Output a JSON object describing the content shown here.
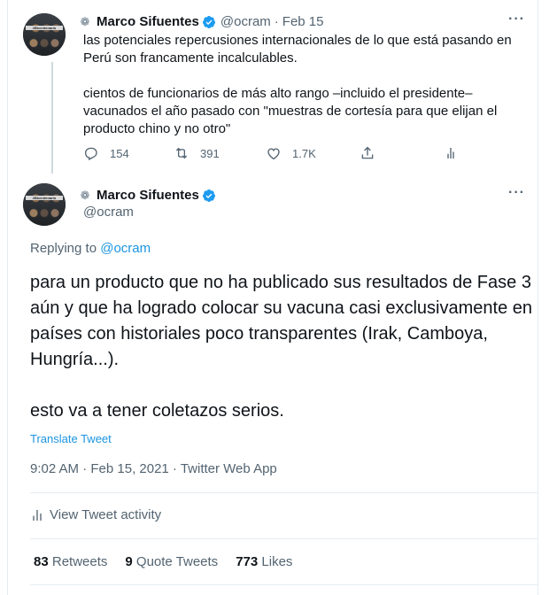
{
  "parent_tweet": {
    "name": "Marco Sifuentes",
    "handle": "@ocram",
    "separator": "·",
    "date": "Feb 15",
    "text": "las potenciales repercusiones internacionales de lo que está pasando en Perú son francamente incalculables.\n\ncientos de funcionarios de más alto rango –incluido el presidente– vacunados el año pasado con \"muestras de cortesía para que elijan el producto chino y no otro\"",
    "replies": "154",
    "retweets": "391",
    "likes": "1.7K",
    "avatar_banner": "#Bicentenario"
  },
  "main_tweet": {
    "name": "Marco Sifuentes",
    "handle": "@ocram",
    "replying_prefix": "Replying to",
    "replying_to": "@ocram",
    "paragraph1": "para un producto que no ha publicado sus resultados de Fase 3 aún y que ha logrado colocar su vacuna casi exclusivamente en países con historiales poco transparentes (Irak, Camboya, Hungría...).",
    "paragraph2": "esto va a tener coletazos serios.",
    "translate": "Translate Tweet",
    "timestamp": "9:02 AM · Feb 15, 2021 · Twitter Web App",
    "activity": "View Tweet activity",
    "retweets_count": "83",
    "retweets_label": "Retweets",
    "quotes_count": "9",
    "quotes_label": "Quote Tweets",
    "likes_count": "773",
    "likes_label": "Likes",
    "avatar_banner": "#Bicentenario"
  },
  "colors": {
    "accent": "#1b95e0",
    "verified": "#1d9bf0",
    "muted": "#536471"
  }
}
